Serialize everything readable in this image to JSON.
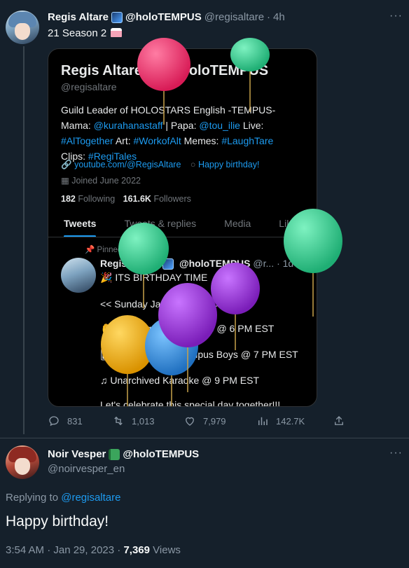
{
  "tweet1": {
    "display_name": "Regis Altare",
    "name_suffix": "@holoTEMPUS",
    "handle": "@regisaltare",
    "time": "4h",
    "text": "21 Season 2",
    "emoji_icon": "birthday-cake-icon",
    "media": {
      "profile_name": "Regis Altare",
      "profile_name_suffix": "@holoTEMPUS",
      "profile_handle": "@regisaltare",
      "bio_line1": "Guild Leader of HOLOSTARS English -TEMPUS-",
      "bio_line2_prefix": "Mama: ",
      "bio_line2_link1": "@kurahanastaff",
      "bio_line2_mid": " | Papa: ",
      "bio_line2_link2": "@tou_ilie",
      "bio_line2_suffix": " Live:",
      "bio_line3_link1": "#AlTogether",
      "bio_line3_mid1": " Art: ",
      "bio_line3_link2": "#WorkofAlt",
      "bio_line3_mid2": " Memes: ",
      "bio_line3_link3": "#LaughTare",
      "bio_line4_prefix": "Clips: ",
      "bio_line4_link": "#RegiTales",
      "website": "youtube.com/@RegisAltare",
      "birthday": "Happy birthday!",
      "joined": "Joined June 2022",
      "following_count": "182",
      "following_label": "Following",
      "followers_count": "161.6K",
      "followers_label": "Followers",
      "tabs": [
        "Tweets",
        "Tweets & replies",
        "Media",
        "Likes"
      ],
      "pinned_label": "Pinned Tweet",
      "pinned_name": "Regis Altare",
      "pinned_suffix": "@holoTEMPUS",
      "pinned_handle": "@r...",
      "pinned_time": "1d",
      "pinned_lines": [
        "ITS BIRTHDAY TIME",
        "<< Sunday January 29th >>",
        "Chatting + Merch Drop @ 6 PM EST",
        "Poker Night w/ Tempus Boys @ 7 PM EST",
        "Unarchived Karaoke @ 9 PM EST",
        "Let's celebrate this special day together!!!"
      ]
    },
    "actions": {
      "replies": "831",
      "retweets": "1,013",
      "likes": "7,979",
      "views": "142.7K"
    }
  },
  "tweet2": {
    "display_name": "Noir Vesper",
    "name_suffix": "@holoTEMPUS",
    "handle": "@noirvesper_en",
    "replying_prefix": "Replying to",
    "replying_to": "@regisaltare",
    "text": "Happy birthday!",
    "timestamp": "3:54 AM · Jan 29, 2023 · ",
    "views_count": "7,369",
    "views_label": "Views"
  },
  "colors": {
    "background": "#15202b",
    "accent": "#1d9bf0",
    "muted": "#8b98a5",
    "balloon_red": "#e0245e",
    "balloon_green": "#2fd08f",
    "balloon_purple": "#9b2ad6",
    "balloon_yellow": "#f4b400",
    "balloon_blue": "#2b8fe0"
  }
}
